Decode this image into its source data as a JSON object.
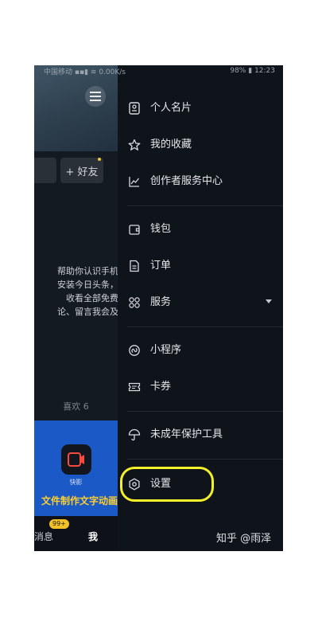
{
  "status_bar": {
    "carrier": "中国移动",
    "speed": "0.00K/s",
    "battery": "98%",
    "time": "12:23"
  },
  "background_page": {
    "add_friend": "+ 好友",
    "text_lines": "帮助你认识手机\n安装今日头条，\n收看全部免费\n论、留言我会及",
    "likes": "喜欢 6",
    "card_app_label": "快影",
    "card_title": "文件制作文字动画",
    "tabbar": {
      "messages": "消息",
      "messages_badge": "99+",
      "me": "我"
    }
  },
  "drawer": {
    "items": [
      {
        "label": "个人名片",
        "icon": "id-card-icon"
      },
      {
        "label": "我的收藏",
        "icon": "star-icon"
      },
      {
        "label": "创作者服务中心",
        "icon": "chart-line-icon"
      },
      {
        "label": "钱包",
        "icon": "wallet-icon"
      },
      {
        "label": "订单",
        "icon": "order-icon"
      },
      {
        "label": "服务",
        "icon": "grid-icon"
      },
      {
        "label": "小程序",
        "icon": "mini-program-icon"
      },
      {
        "label": "卡券",
        "icon": "ticket-icon"
      },
      {
        "label": "未成年保护工具",
        "icon": "umbrella-icon"
      },
      {
        "label": "设置",
        "icon": "gear-icon"
      }
    ]
  },
  "watermark": "知乎 @雨泽",
  "colors": {
    "background": "#0f141b",
    "highlight": "#f3ef2a",
    "badge": "#f4c028",
    "card": "#1b59c6"
  }
}
